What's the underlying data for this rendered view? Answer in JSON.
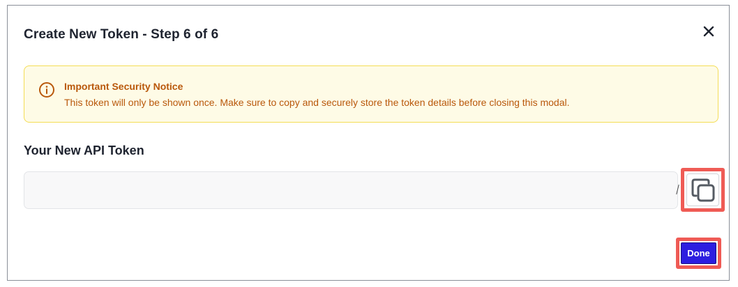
{
  "modal": {
    "title": "Create New Token - Step 6 of 6"
  },
  "notice": {
    "icon": "info-circle-icon",
    "title": "Important Security Notice",
    "body": "This token will only be shown once. Make sure to copy and securely store the token details before closing this modal.",
    "color": "#b9580b",
    "background": "#fefbe6",
    "border": "#f4dd55"
  },
  "token": {
    "heading": "Your New API Token",
    "value": "",
    "placeholder": ""
  },
  "actions": {
    "done_label": "Done",
    "done_color": "#2d1ee0",
    "highlight_color": "#ef5b55"
  },
  "icons": {
    "close": "close-icon",
    "copy": "copy-icon"
  }
}
